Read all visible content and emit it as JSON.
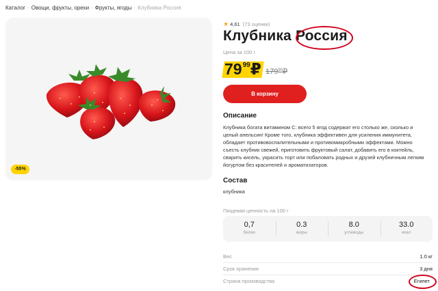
{
  "breadcrumb": {
    "items": [
      "Каталог",
      "Овощи, фрукты, орехи",
      "Фрукты, ягоды"
    ],
    "current": "Клубника Россия",
    "separator": "·"
  },
  "product": {
    "discount": "-55%",
    "rating": "4,61",
    "rating_count": "(73 оценки)",
    "title_name": "Клубника",
    "title_origin": "Россия",
    "unit_price_label": "Цена за 100 г",
    "price_main": "79",
    "price_cents": "99",
    "currency": "₽",
    "old_price_main": "179",
    "old_price_cents": "90",
    "add_to_cart_label": "В корзину"
  },
  "description": {
    "title": "Описание",
    "text": "Клубника богата витамином С: всего 5 ягод содержат его столько же, сколько и целый апельсин! Кроме того, клубника эффективен для усиления иммунитета, обладает противовоспалительными и противомикробными эффектами. Можно съесть клубник свежей, приготовить фруктовый салат, добавить его в коктейль, сварить кисель, украсить торт или побаловать родных и друзей клубничным легким йогуртом без красителей и ароматизаторов."
  },
  "composition": {
    "title": "Состав",
    "text": "клубника"
  },
  "nutrition": {
    "label": "Пищевая ценность на 100 г",
    "items": [
      {
        "value": "0,7",
        "name": "белки"
      },
      {
        "value": "0.3",
        "name": "жиры"
      },
      {
        "value": "8.0",
        "name": "углеводы"
      },
      {
        "value": "33.0",
        "name": "ккал"
      }
    ]
  },
  "specs": [
    {
      "key": "Вес",
      "value": "1.0 кг"
    },
    {
      "key": "Срок хранения",
      "value": "3 дня"
    },
    {
      "key": "Страна производства",
      "value": "Египет"
    }
  ],
  "colors": {
    "accent_red": "#e0201f",
    "price_yellow": "#ffd400",
    "annotation_red": "#d0021b"
  },
  "icons": {
    "rating": "star-icon"
  }
}
